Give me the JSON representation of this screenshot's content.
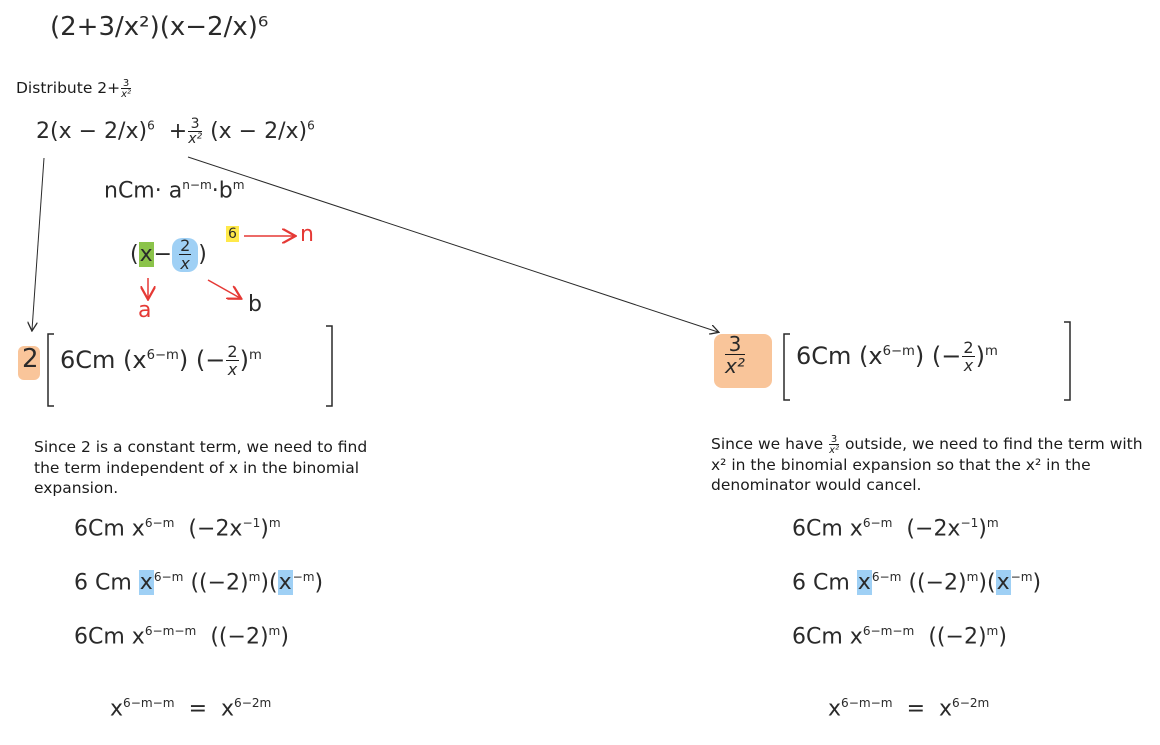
{
  "colors": {
    "ink": "#2a2a2a",
    "arrow_red": "#e53935",
    "hl_green": "#8bc34a",
    "hl_blue": "#9fd0f5",
    "hl_yellow": "#ffe94a",
    "hl_orange": "#f9c59a"
  },
  "top_expr": "(2+3/x²)(x−2/x)⁶",
  "distribute": {
    "prefix": "Distribute 2+",
    "frac_num": "3",
    "frac_den": "x²"
  },
  "step1": {
    "coef": "2",
    "term2_coef_num": "3",
    "term2_coef_den": "x²",
    "paren_inner": "x − 2/x",
    "power": "6",
    "formula": "nCm· a",
    "formula_exp": "n−m",
    "formula_b": "·b",
    "formula_b_exp": "m"
  },
  "annot": {
    "x": "x",
    "minus": "−",
    "frac_num": "2",
    "frac_den": "x",
    "power": "6",
    "n_label": "n",
    "a_label": "a",
    "b_label": "b"
  },
  "left": {
    "outer_coef": "2",
    "inner": "6Cm (x",
    "inner_exp": "6−m",
    "inner_close": ")",
    "frac_part": "(−",
    "frac_num": "2",
    "frac_den": "x",
    "frac_close": ")",
    "m_exp": "m",
    "explanation": "Since 2 is a constant term, we need to find the term independent of x in the binomial expansion.",
    "line1": "6Cm x",
    "line1_exp": "6−m",
    "line1_tail": "(−2x",
    "line1_tail_exp": "−1",
    "line1_close": ")",
    "line1_m": "m",
    "line2": "6 Cm",
    "line2_x": "x",
    "line2_exp": "6−m",
    "line2_mid": "((−2)",
    "line2_mid_exp": "m",
    "line2_mid2": ")(",
    "line2_x2": "x",
    "line2_x2_exp": "−m",
    "line2_close": ")",
    "line3": "6Cm x",
    "line3_exp": "6−m−m",
    "line3_tail": "((−2)",
    "line3_tail_exp": "m",
    "line3_close": ")",
    "line4_x": "x",
    "line4_exp": "6−m−m",
    "line4_eq": "=",
    "line4_x2": "x",
    "line4_exp2": "6−2m"
  },
  "right": {
    "coef_num": "3",
    "coef_den": "x²",
    "inner": "6Cm (x",
    "inner_exp": "6−m",
    "inner_close": ")",
    "frac_part": "(−",
    "frac_num": "2",
    "frac_den": "x",
    "frac_close": ")",
    "m_exp": "m",
    "explanation_pre": "Since we have",
    "explanation_num": "3",
    "explanation_den": "x²",
    "explanation_post": "outside, we need to find the term with x² in the binomial expansion so that the x² in the denominator would cancel.",
    "line1": "6Cm x",
    "line1_exp": "6−m",
    "line1_tail": "(−2x",
    "line1_tail_exp": "−1",
    "line1_close": ")",
    "line1_m": "m",
    "line2": "6 Cm",
    "line2_x": "x",
    "line2_exp": "6−m",
    "line2_mid": "((−2)",
    "line2_mid_exp": "m",
    "line2_mid2": ")(",
    "line2_x2": "x",
    "line2_x2_exp": "−m",
    "line2_close": ")",
    "line3": "6Cm x",
    "line3_exp": "6−m−m",
    "line3_tail": "((−2)",
    "line3_tail_exp": "m",
    "line3_close": ")",
    "line4_x": "x",
    "line4_exp": "6−m−m",
    "line4_eq": "=",
    "line4_x2": "x",
    "line4_exp2": "6−2m"
  }
}
